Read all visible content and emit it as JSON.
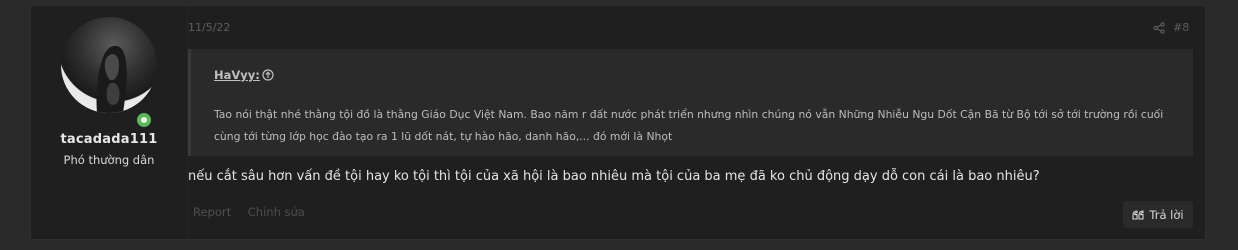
{
  "user": {
    "name": "tacadada111",
    "title": "Phó thường dân",
    "online": true
  },
  "post": {
    "date": "11/5/22",
    "number": "#8",
    "message": "nếu cắt sâu hơn vấn đề tội hay ko tội thì tội của xã hội là bao nhiêu mà tội của ba mẹ đã ko chủ động dạy dỗ con cái là bao nhiêu?"
  },
  "quote": {
    "author": "HaVyy:",
    "text": "Tao nói thật nhé thằng tội đồ là thằng Giáo Dục Việt Nam. Bao năm r đất nước phát triển nhưng nhìn chúng nó vẫn Những Nhiễu Ngu Dốt Cận Bã từ Bộ tới sở tới trường rồi cuối cùng tới từng lớp học đào tạo ra 1 lũ dốt nát, tự hào hão, danh hão,... đó mới là Nhọt"
  },
  "actions": {
    "report": "Report",
    "edit": "Chỉnh sửa",
    "reply": "Trả lời"
  },
  "icons": {
    "share": "share-icon",
    "quote_jump": "arrow-up-circle-icon",
    "reply": "quote-icon"
  },
  "colors": {
    "online": "#5cb85c",
    "background": "#1f1f1f"
  }
}
